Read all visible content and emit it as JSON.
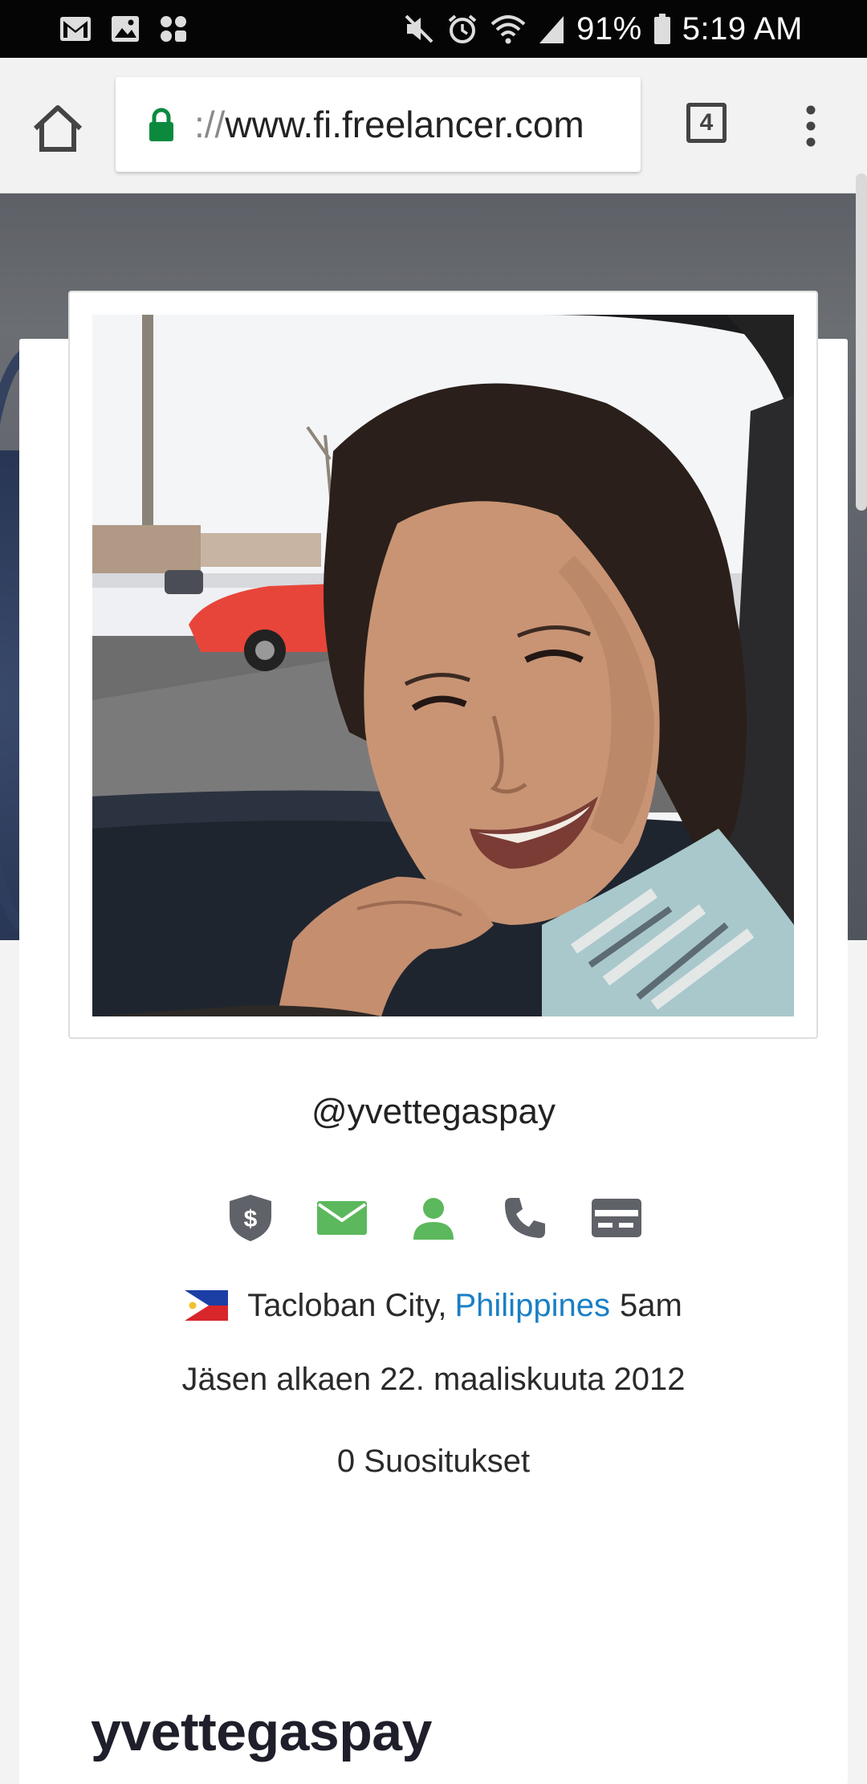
{
  "status_bar": {
    "battery": "91%",
    "time": "5:19 AM",
    "left_icons": [
      "gmail-icon",
      "gallery-icon",
      "app-icon"
    ],
    "right_icons": [
      "mute-icon",
      "alarm-icon",
      "wifi-icon",
      "signal-icon",
      "battery-icon"
    ]
  },
  "browser": {
    "url_scheme": "://",
    "url_host": "www.fi.freelancer.com",
    "tab_count": "4"
  },
  "profile": {
    "username": "@yvettegaspay",
    "verification_icons": [
      "payment-verified-icon",
      "email-verified-icon",
      "profile-verified-icon",
      "phone-verified-icon",
      "card-verified-icon"
    ],
    "city": "Tacloban City,",
    "country": "Philippines",
    "local_time": "5am",
    "member_since": "Jäsen alkaen 22. maaliskuuta 2012",
    "recommendations": "0 Suositukset",
    "display_name": "yvettegaspay"
  },
  "colors": {
    "link": "#1a7fc6",
    "verified_green": "#5cb85c",
    "unverified_gray": "#5f6268"
  }
}
